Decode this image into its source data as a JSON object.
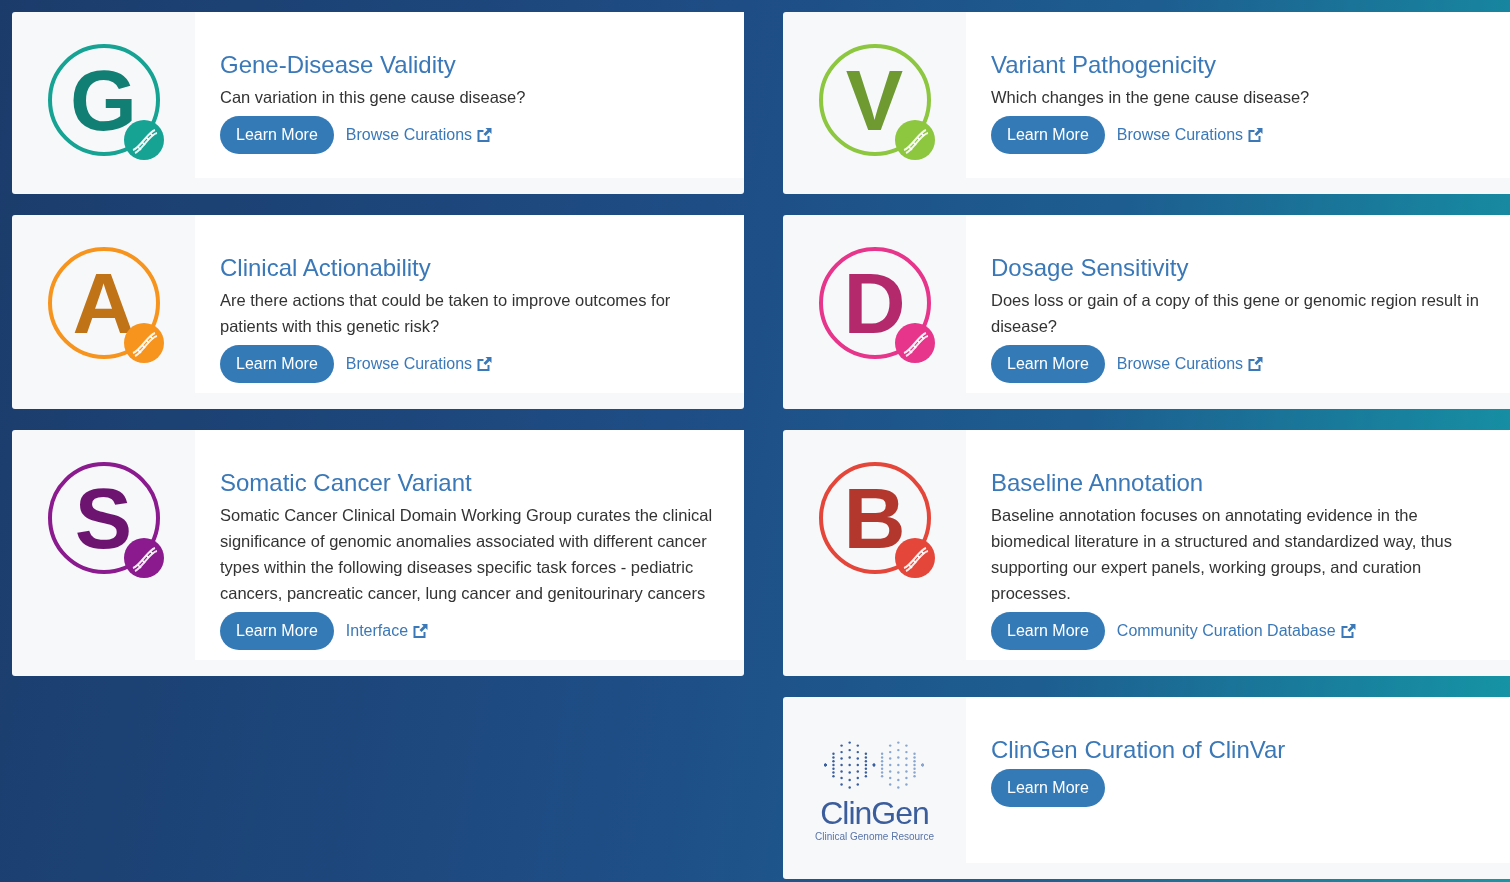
{
  "columns": [
    {
      "cards": [
        {
          "logo": {
            "kind": "letter",
            "letter": "G",
            "color": "#16a394"
          },
          "title": "Gene-Disease Validity",
          "description": "Can variation in this gene cause disease?",
          "button": "Learn More",
          "link": "Browse Curations"
        },
        {
          "logo": {
            "kind": "letter",
            "letter": "A",
            "color": "#f7941d"
          },
          "title": "Clinical Actionability",
          "description": "Are there actions that could be taken to improve outcomes for patients with this genetic risk?",
          "button": "Learn More",
          "link": "Browse Curations"
        },
        {
          "logo": {
            "kind": "letter",
            "letter": "S",
            "color": "#8b1a8f"
          },
          "title": "Somatic Cancer Variant",
          "description": "Somatic Cancer Clinical Domain Working Group curates the clinical significance of genomic anomalies associated with different cancer types within the following diseases specific task forces - pediatric cancers, pancreatic cancer, lung cancer and genitourinary cancers",
          "button": "Learn More",
          "link": "Interface"
        }
      ]
    },
    {
      "cards": [
        {
          "logo": {
            "kind": "letter",
            "letter": "V",
            "color": "#8dc63f"
          },
          "title": "Variant Pathogenicity",
          "description": "Which changes in the gene cause disease?",
          "button": "Learn More",
          "link": "Browse Curations"
        },
        {
          "logo": {
            "kind": "letter",
            "letter": "D",
            "color": "#e6358b"
          },
          "title": "Dosage Sensitivity",
          "description": "Does loss or gain of a copy of this gene or genomic region result in disease?",
          "button": "Learn More",
          "link": "Browse Curations"
        },
        {
          "logo": {
            "kind": "letter",
            "letter": "B",
            "color": "#e5463a"
          },
          "title": "Baseline Annotation",
          "description": "Baseline annotation focuses on annotating evidence in the biomedical literature in a structured and standardized way, thus supporting our expert panels, working groups, and curation processes.",
          "button": "Learn More",
          "link": "Community Curation Database"
        },
        {
          "logo": {
            "kind": "clingen",
            "name": "ClinGen",
            "tagline": "Clinical Genome Resource"
          },
          "title": "ClinGen Curation of ClinVar",
          "button": "Learn More"
        }
      ]
    }
  ]
}
